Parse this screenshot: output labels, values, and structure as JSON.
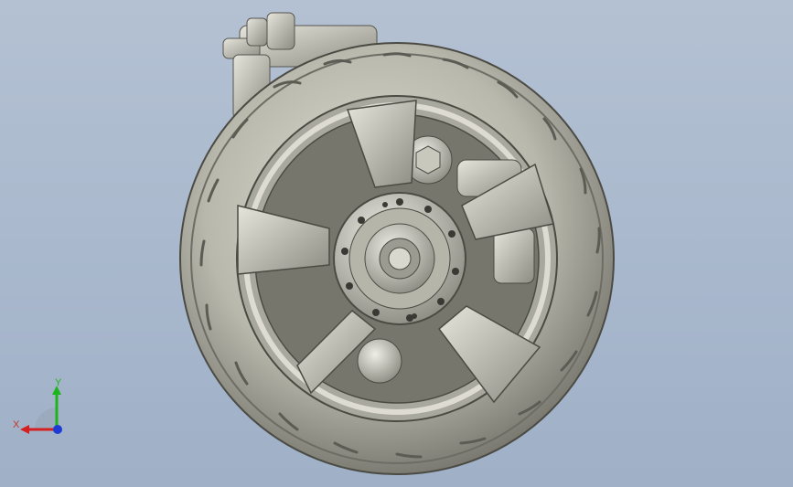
{
  "viewport": {
    "background_top": "#b4c1d3",
    "background_bottom": "#9fb0c7"
  },
  "model": {
    "rim_color": "#c9c8bd",
    "shadow_color": "#6a6a60",
    "spoke_count": 5,
    "bolt_count": 12
  },
  "triad": {
    "x_label": "X",
    "y_label": "Y",
    "x_color": "#d42020",
    "y_color": "#1eb41e",
    "z_color": "#1e3cd4"
  }
}
